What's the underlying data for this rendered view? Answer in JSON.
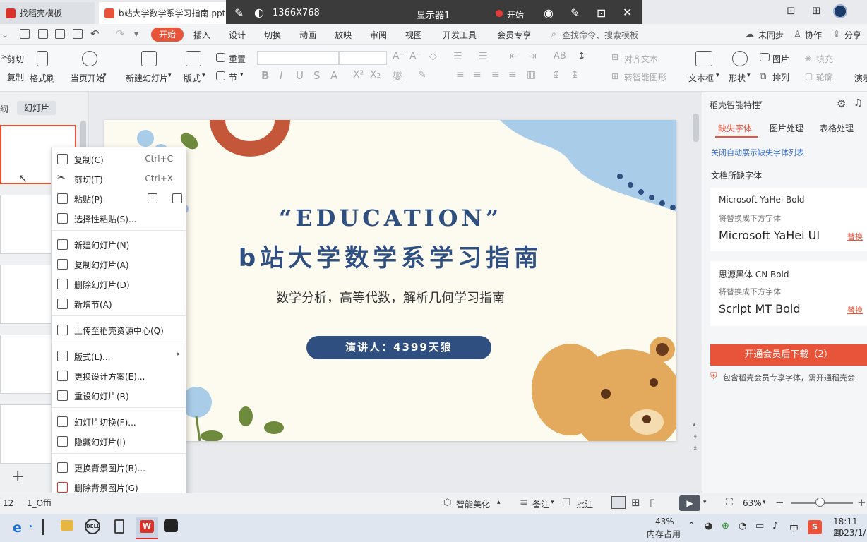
{
  "tabs": {
    "tab1": "找稻壳模板",
    "tab2": "b站大学数学系学习指南.pptx"
  },
  "recorder": {
    "resolution": "1366X768",
    "monitor": "显示器1",
    "start": "开始"
  },
  "menu": {
    "items": [
      "开始",
      "插入",
      "设计",
      "切换",
      "动画",
      "放映",
      "审阅",
      "视图",
      "开发工具",
      "会员专享"
    ],
    "search": "查找命令、搜索模板",
    "sync": "未同步",
    "collab": "协作",
    "share": "分享"
  },
  "ribbon": {
    "cut": "剪切",
    "copy": "复制",
    "format_painter": "格式刷",
    "from_current": "当页开始",
    "new_slide": "新建幻灯片",
    "layout": "版式",
    "reset": "重置",
    "section": "节",
    "align_text": "对齐文本",
    "smart_shape": "转智能图形",
    "textbox": "文本框",
    "shape": "形状",
    "picture": "图片",
    "arrange": "排列",
    "fill": "填充",
    "outline": "轮廓",
    "present": "演示"
  },
  "left_panel": {
    "outline_tab": "纲",
    "slides_tab": "幻灯片"
  },
  "slide": {
    "quote_title": "“EDUCATION”",
    "main_title": "b站大学数学系学习指南",
    "subtitle": "数学分析，高等代数，解析几何学习指南",
    "presenter": "演讲人：4399天狼"
  },
  "context_menu": {
    "items": [
      {
        "label": "复制(C)",
        "shortcut": "Ctrl+C",
        "icon": "copy-icon"
      },
      {
        "label": "剪切(T)",
        "shortcut": "Ctrl+X",
        "icon": "scissors-icon"
      },
      {
        "label": "粘贴(P)",
        "shortcut": "",
        "icon": "paste-icon"
      },
      {
        "label": "选择性粘贴(S)...",
        "shortcut": "",
        "icon": "paste-special-icon"
      },
      {
        "label": "新建幻灯片(N)",
        "shortcut": "",
        "icon": "new-slide-icon"
      },
      {
        "label": "复制幻灯片(A)",
        "shortcut": "",
        "icon": "duplicate-slide-icon"
      },
      {
        "label": "删除幻灯片(D)",
        "shortcut": "",
        "icon": "delete-slide-icon"
      },
      {
        "label": "新增节(A)",
        "shortcut": "",
        "icon": "section-icon"
      },
      {
        "label": "上传至稻壳资源中心(Q)",
        "shortcut": "",
        "icon": "upload-icon"
      },
      {
        "label": "版式(L)...",
        "shortcut": "",
        "icon": "layout-icon"
      },
      {
        "label": "更换设计方案(E)...",
        "shortcut": "",
        "icon": "design-icon"
      },
      {
        "label": "重设幻灯片(R)",
        "shortcut": "",
        "icon": "reset-icon"
      },
      {
        "label": "幻灯片切换(F)...",
        "shortcut": "",
        "icon": "transition-icon"
      },
      {
        "label": "隐藏幻灯片(I)",
        "shortcut": "",
        "icon": "hide-icon"
      },
      {
        "label": "更换背景图片(B)...",
        "shortcut": "",
        "icon": "background-icon"
      },
      {
        "label": "删除背景图片(G)",
        "shortcut": "",
        "icon": "delete-background-icon"
      }
    ]
  },
  "right_panel": {
    "title": "稻壳智能特性",
    "tabs": [
      "缺失字体",
      "图片处理",
      "表格处理"
    ],
    "close_link": "关闭自动展示缺失字体列表",
    "section": "文档所缺字体",
    "fonts": [
      {
        "missing": "Microsoft YaHei Bold",
        "hint": "将替换成下方字体",
        "replacement": "Microsoft YaHei UI",
        "action": "替换"
      },
      {
        "missing": "思源黑体 CN Bold",
        "hint": "将替换成下方字体",
        "replacement": "Script MT Bold",
        "action": "替换"
      }
    ],
    "vip_button": "开通会员后下载（2）",
    "vip_note": "包含稻壳会员专享字体，需开通稻壳会"
  },
  "status": {
    "slide_num": "12",
    "theme": "1_Offi",
    "beautify": "智能美化",
    "notes": "备注",
    "comment": "批注",
    "zoom": "63%"
  },
  "taskbar": {
    "mem_percent": "43%",
    "mem_label": "内存占用",
    "time": "18:11 周-",
    "date": "2023/1/"
  },
  "colors": {
    "accent": "#e8543a",
    "navy": "#2e4f80",
    "vip": "#e8543a"
  }
}
